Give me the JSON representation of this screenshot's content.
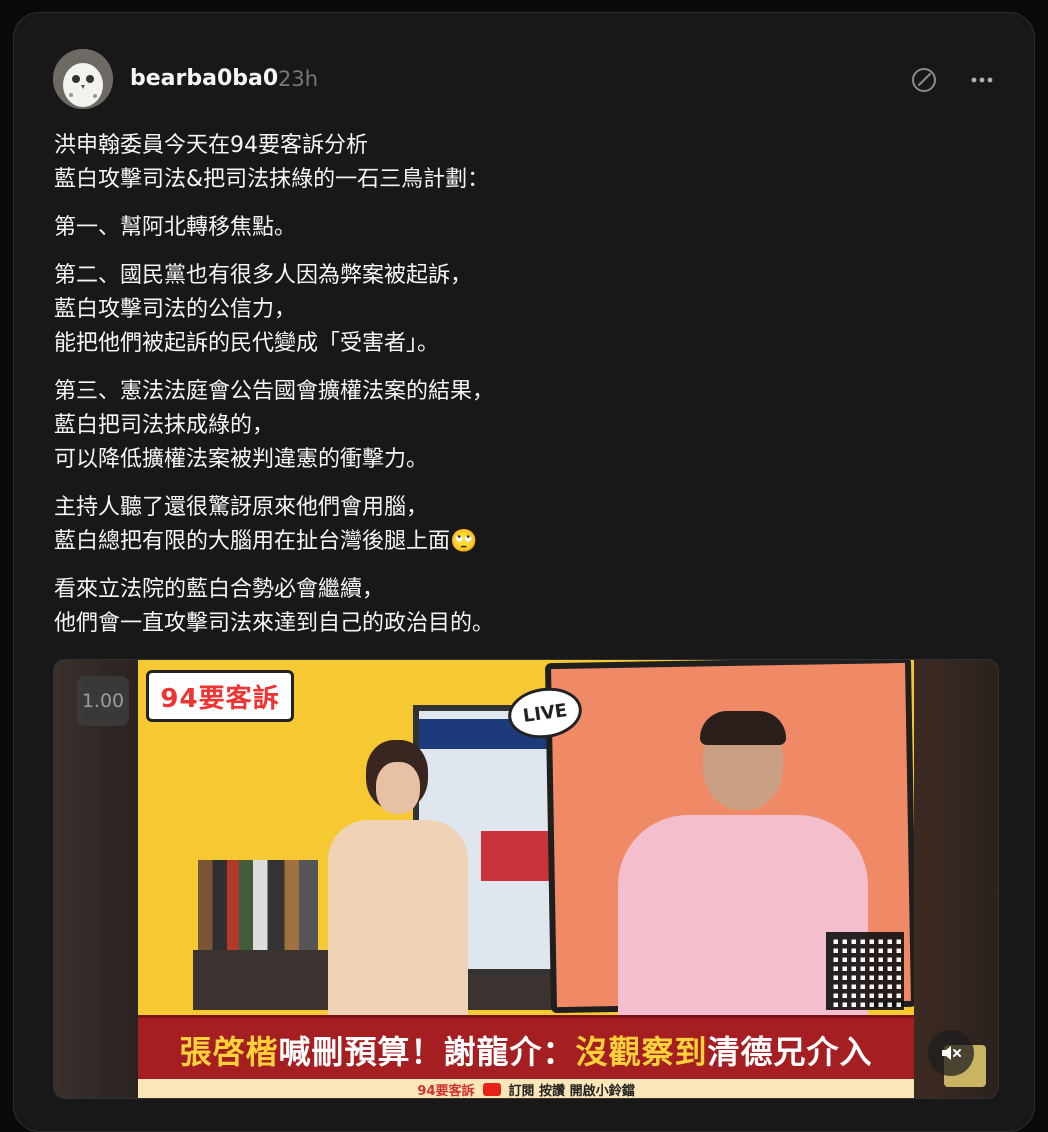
{
  "post": {
    "username": "bearba0ba0",
    "timestamp": "23h",
    "paragraphs": [
      "洪申翰委員今天在94要客訴分析\n藍白攻擊司法&把司法抹綠的一石三鳥計劃：",
      "第一、幫阿北轉移焦點。",
      "第二、國民黨也有很多人因為弊案被起訴，\n藍白攻擊司法的公信力，\n能把他們被起訴的民代變成「受害者」。",
      "第三、憲法法庭會公告國會擴權法案的結果，\n藍白把司法抹成綠的，\n可以降低擴權法案被判違憲的衝擊力。",
      "主持人聽了還很驚訝原來他們會用腦，\n藍白總把有限的大腦用在扯台灣後腿上面🙄",
      "看來立法院的藍白合勢必會繼續，\n他們會一直攻擊司法來達到自己的政治目的。"
    ]
  },
  "video": {
    "speed": "1.00",
    "show_logo": "94要客訴",
    "live": "LIVE",
    "caption_a": "張啓楷",
    "caption_b": "喊刪預算！謝龍介：",
    "caption_c": "沒觀察到",
    "caption_d": "清德兄介入",
    "sub_brand": "94要客訴",
    "sub_text": "訂閱 按讚 開啟小鈴鐺"
  },
  "colors": {
    "background": "#0a0a0a",
    "card": "#181818",
    "text": "#f3f5f7",
    "muted": "#777777",
    "caption_red": "#a51e22",
    "caption_yellow": "#ffd23a"
  },
  "icons": [
    "avatar-owl",
    "edit-icon",
    "more-icon",
    "mute-icon"
  ]
}
